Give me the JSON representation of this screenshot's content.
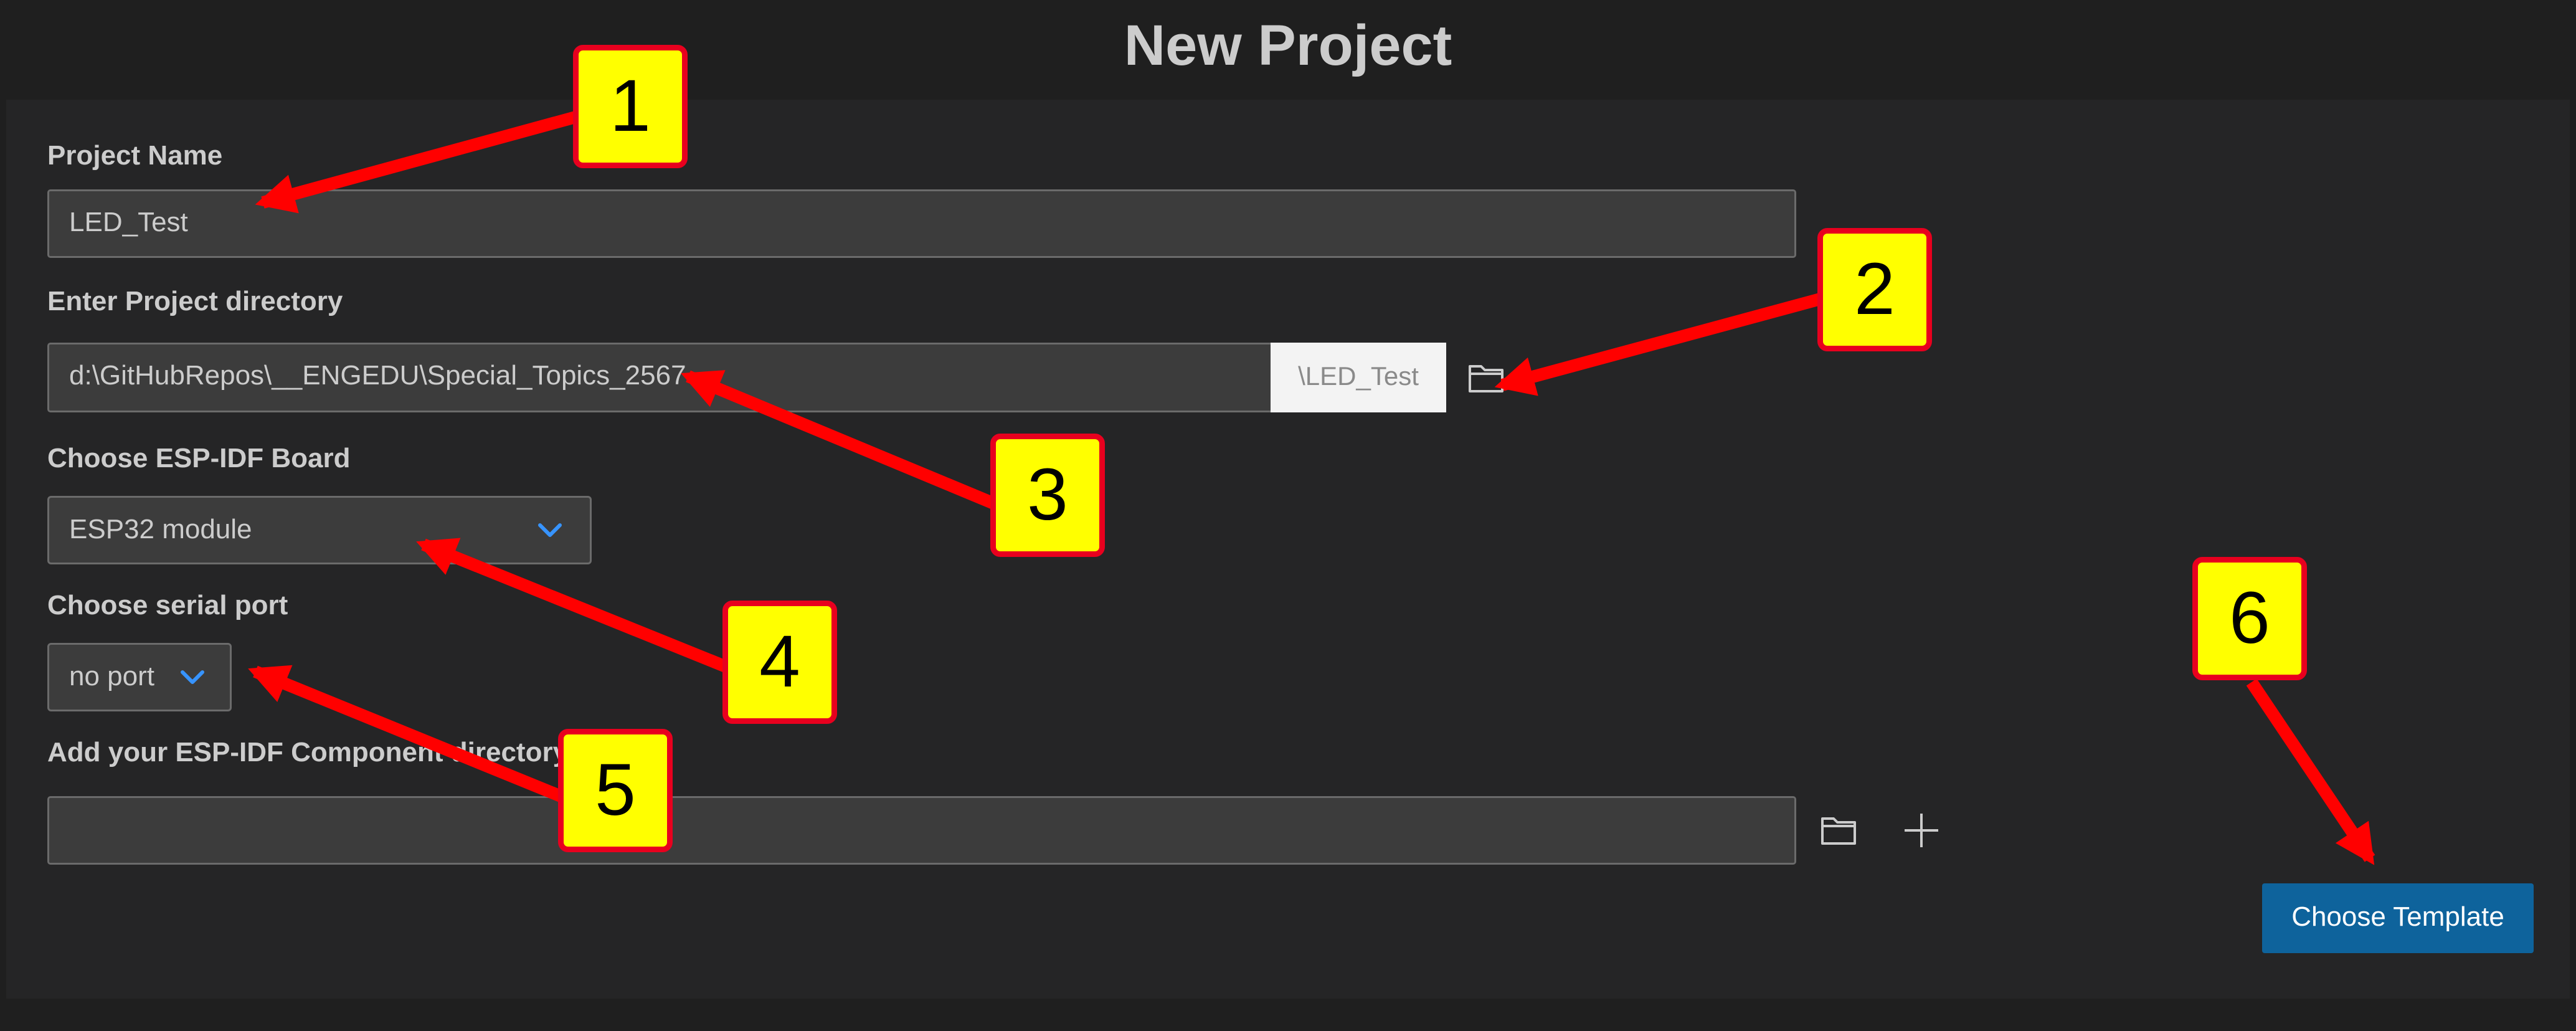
{
  "page": {
    "title": "New Project"
  },
  "form": {
    "project_name": {
      "label": "Project Name",
      "value": "LED_Test"
    },
    "project_directory": {
      "label": "Enter Project directory",
      "value": "d:\\GitHubRepos\\__ENGEDU\\Special_Topics_2567",
      "suffix": "\\LED_Test",
      "browse_icon": "folder-icon"
    },
    "board": {
      "label": "Choose ESP-IDF Board",
      "selected": "ESP32 module",
      "icon": "chevron-down-icon"
    },
    "serial_port": {
      "label": "Choose serial port",
      "selected": "no port",
      "icon": "chevron-down-icon"
    },
    "component_directory": {
      "label": "Add your ESP-IDF Component directory",
      "value": "",
      "browse_icon": "folder-icon",
      "add_icon": "plus-icon"
    },
    "choose_template_label": "Choose Template"
  },
  "annotations": {
    "callouts": [
      "1",
      "2",
      "3",
      "4",
      "5",
      "6"
    ]
  },
  "colors": {
    "background": "#1f1f1f",
    "panel": "#252526",
    "input_bg": "#3c3c3c",
    "primary_button": "#0e639c",
    "chevron": "#3794ff",
    "callout_fill": "#ffff00",
    "callout_border": "#e8001e",
    "arrow": "#ff0000"
  }
}
